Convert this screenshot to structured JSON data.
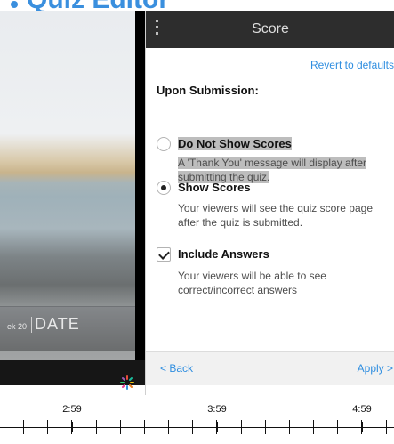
{
  "app": {
    "title": "Quiz Editor"
  },
  "video": {
    "date_prefix": "ek 20",
    "date_text": "DATE"
  },
  "panel": {
    "title": "Score",
    "revert_label": "Revert to defaults",
    "section_label": "Upon Submission:",
    "options": [
      {
        "title": "Do Not Show Scores",
        "description": "A 'Thank You' message will display after submitting the quiz.",
        "selected": false
      },
      {
        "title": "Show Scores",
        "description": "Your viewers will see the quiz score page after the quiz is submitted.",
        "selected": true
      }
    ],
    "include_answers": {
      "title": "Include Answers",
      "description": "Your viewers will be able to see correct/incorrect answers",
      "checked": true
    },
    "footer": {
      "back_label": "< Back",
      "apply_label": "Apply >"
    }
  },
  "timeline": {
    "labels": [
      "2:59",
      "3:59",
      "4:59"
    ]
  },
  "colors": {
    "accent": "#2f8ee0",
    "header_bg": "#2d2d2d",
    "title_blue": "#3a8fde"
  }
}
